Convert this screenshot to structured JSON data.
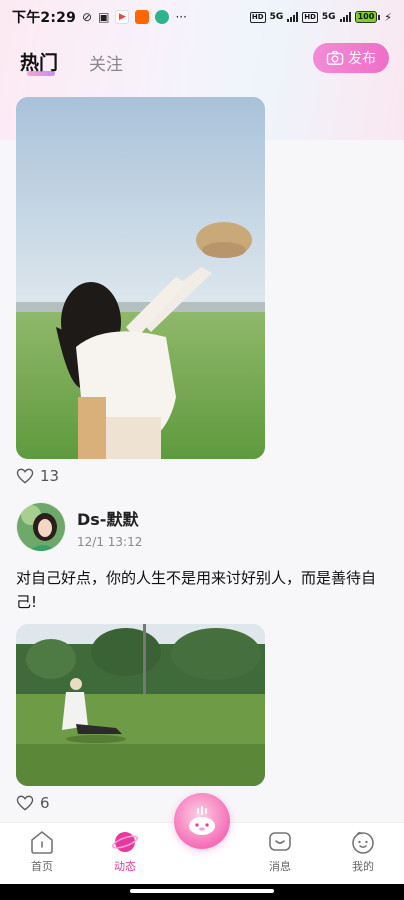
{
  "status_bar": {
    "time": "下午2:29",
    "network": "5G",
    "network2": "5G",
    "hd": "HD",
    "battery": "100"
  },
  "header": {
    "tab_hot": "热门",
    "tab_follow": "关注",
    "publish_label": "发布"
  },
  "feed": {
    "post1": {
      "likes": "13"
    },
    "post2": {
      "author_name": "Ds-默默",
      "time": "12/1 13:12",
      "text": "对自己好点，你的人生不是用来讨好别人，而是善待自己!",
      "likes": "6"
    }
  },
  "bottom_nav": {
    "items": [
      {
        "label": "首页",
        "icon": "home-icon"
      },
      {
        "label": "动态",
        "icon": "planet-icon"
      },
      {
        "label": "消息",
        "icon": "message-icon"
      },
      {
        "label": "我的",
        "icon": "profile-icon"
      }
    ],
    "active": "动态"
  },
  "colors": {
    "accent": "#e8379d",
    "publish": "#ef72c9"
  }
}
